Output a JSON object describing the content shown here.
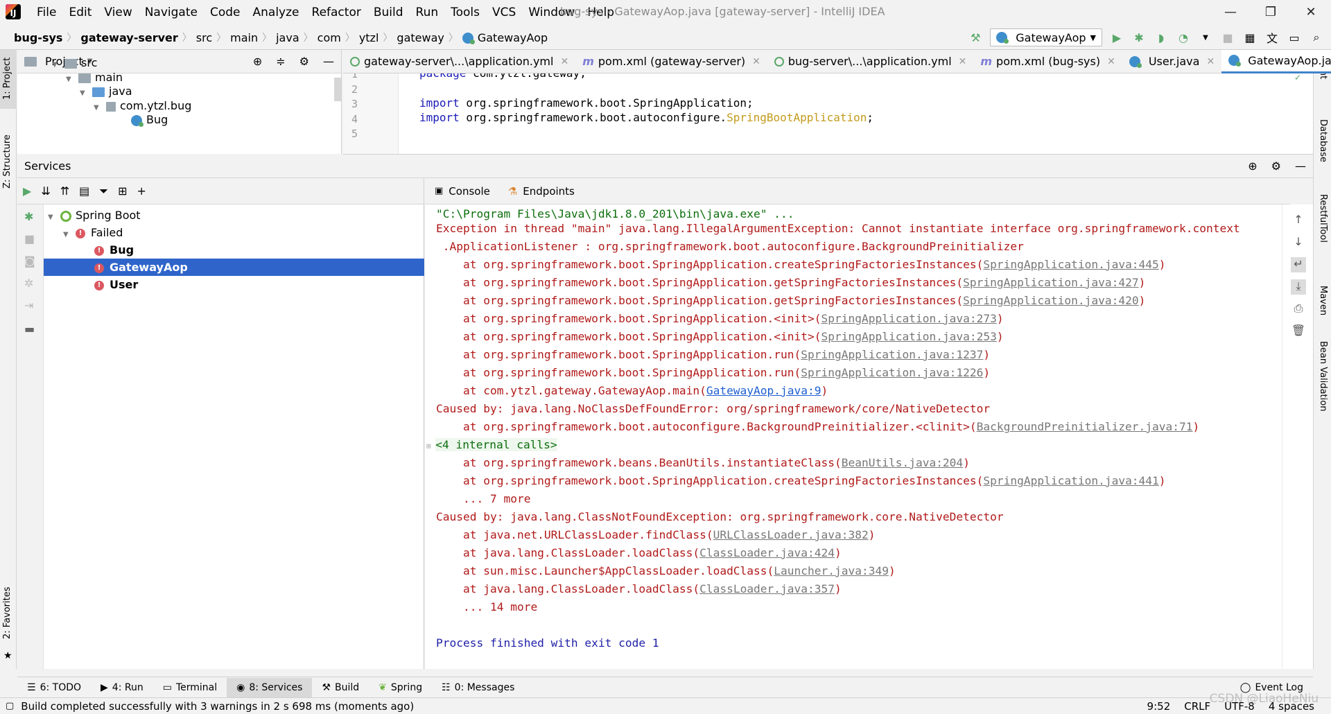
{
  "window": {
    "title": "bug-sys - GatewayAop.java [gateway-server] - IntelliJ IDEA",
    "menu": [
      "File",
      "Edit",
      "View",
      "Navigate",
      "Code",
      "Analyze",
      "Refactor",
      "Build",
      "Run",
      "Tools",
      "VCS",
      "Window",
      "Help"
    ]
  },
  "breadcrumbs": [
    "bug-sys",
    "gateway-server",
    "src",
    "main",
    "java",
    "com",
    "ytzl",
    "gateway",
    "GatewayAop"
  ],
  "run_config": "GatewayAop",
  "left_stripe": {
    "project": "1: Project",
    "structure": "Z: Structure",
    "favorites": "2: Favorites"
  },
  "right_stripe": [
    "Ant",
    "Database",
    "RestfulTool",
    "Maven",
    "Bean Validation"
  ],
  "project_panel": {
    "title": "Project",
    "tree": [
      "src",
      "main",
      "java",
      "com.ytzl.bug",
      "Bug"
    ]
  },
  "editor": {
    "tabs": [
      {
        "label": "gateway-server\\...\\application.yml",
        "type": "yml"
      },
      {
        "label": "pom.xml (gateway-server)",
        "type": "maven"
      },
      {
        "label": "bug-server\\...\\application.yml",
        "type": "yml"
      },
      {
        "label": "pom.xml (bug-sys)",
        "type": "maven"
      },
      {
        "label": "User.java",
        "type": "java"
      },
      {
        "label": "GatewayAop.java",
        "type": "java"
      }
    ],
    "active_tab": "GatewayAop.java",
    "line_numbers": [
      "1",
      "2",
      "3",
      "4",
      "5"
    ],
    "code": {
      "l1_kw": "package",
      "l1_rest": " com.ytzl.gateway;",
      "l3_kw": "import",
      "l3_rest": " org.springframework.boot.SpringApplication;",
      "l4_kw": "import",
      "l4_mid": " org.springframework.boot.autoconfigure.",
      "l4_ann": "SpringBootApplication",
      "l4_end": ";"
    }
  },
  "services": {
    "title": "Services",
    "tree": {
      "root": "Spring Boot",
      "group": "Failed",
      "items": [
        "Bug",
        "GatewayAop",
        "User"
      ],
      "selected": "GatewayAop"
    },
    "console_tabs": [
      "Console",
      "Endpoints"
    ]
  },
  "console": {
    "cmd": "\"C:\\Program Files\\Java\\jdk1.8.0_201\\bin\\java.exe\" ...",
    "exception_1": "Exception in thread \"main\" java.lang.IllegalArgumentException: Cannot instantiate interface org.springframework.context",
    "exception_2": " .ApplicationListener : org.springframework.boot.autoconfigure.BackgroundPreinitializer",
    "frames_a": [
      {
        "pre": "    at org.springframework.boot.SpringApplication.createSpringFactoriesInstances(",
        "link": "SpringApplication.java:445",
        "post": ")"
      },
      {
        "pre": "    at org.springframework.boot.SpringApplication.getSpringFactoriesInstances(",
        "link": "SpringApplication.java:427",
        "post": ")"
      },
      {
        "pre": "    at org.springframework.boot.SpringApplication.getSpringFactoriesInstances(",
        "link": "SpringApplication.java:420",
        "post": ")"
      },
      {
        "pre": "    at org.springframework.boot.SpringApplication.<init>(",
        "link": "SpringApplication.java:273",
        "post": ")"
      },
      {
        "pre": "    at org.springframework.boot.SpringApplication.<init>(",
        "link": "SpringApplication.java:253",
        "post": ")"
      },
      {
        "pre": "    at org.springframework.boot.SpringApplication.run(",
        "link": "SpringApplication.java:1237",
        "post": ")"
      },
      {
        "pre": "    at org.springframework.boot.SpringApplication.run(",
        "link": "SpringApplication.java:1226",
        "post": ")"
      },
      {
        "pre": "    at com.ytzl.gateway.GatewayAop.main(",
        "link": "GatewayAop.java:9",
        "post": ")"
      }
    ],
    "caused_1": "Caused by: java.lang.NoClassDefFoundError: org/springframework/core/NativeDetector",
    "frame_b1": {
      "pre": "    at org.springframework.boot.autoconfigure.BackgroundPreinitializer.<clinit>(",
      "link": "BackgroundPreinitializer.java:71",
      "post": ")"
    },
    "internal_calls": "<4 internal calls>",
    "frames_b": [
      {
        "pre": "    at org.springframework.beans.BeanUtils.instantiateClass(",
        "link": "BeanUtils.java:204",
        "post": ")"
      },
      {
        "pre": "    at org.springframework.boot.SpringApplication.createSpringFactoriesInstances(",
        "link": "SpringApplication.java:441",
        "post": ")"
      }
    ],
    "more_1": "    ... 7 more",
    "caused_2": "Caused by: java.lang.ClassNotFoundException: org.springframework.core.NativeDetector",
    "frames_c": [
      {
        "pre": "    at java.net.URLClassLoader.findClass(",
        "link": "URLClassLoader.java:382",
        "post": ")"
      },
      {
        "pre": "    at java.lang.ClassLoader.loadClass(",
        "link": "ClassLoader.java:424",
        "post": ")"
      },
      {
        "pre": "    at sun.misc.Launcher$AppClassLoader.loadClass(",
        "link": "Launcher.java:349",
        "post": ")"
      },
      {
        "pre": "    at java.lang.ClassLoader.loadClass(",
        "link": "ClassLoader.java:357",
        "post": ")"
      }
    ],
    "more_2": "    ... 14 more",
    "finished": "Process finished with exit code 1"
  },
  "bottom_tabs": [
    "6: TODO",
    "4: Run",
    "Terminal",
    "8: Services",
    "Build",
    "Spring",
    "0: Messages"
  ],
  "active_bottom_tab": "8: Services",
  "event_log": "Event Log",
  "status": {
    "message": "Build completed successfully with 3 warnings in 2 s 698 ms (moments ago)",
    "position": "9:52",
    "line_sep": "CRLF",
    "encoding": "UTF-8",
    "indent": "4 spaces",
    "watermark": "CSDN @LiaoHeNiu"
  },
  "colors": {
    "selection": "#2f65ca",
    "error_text": "#b11a1a",
    "link_blue": "#1f5fd0",
    "spring_green": "#6db33f"
  }
}
